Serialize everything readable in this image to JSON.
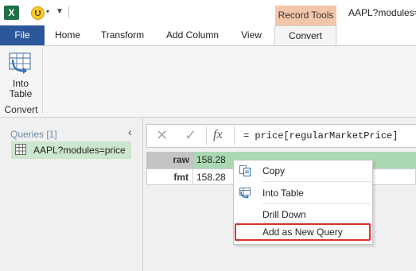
{
  "app": {
    "window_title": "AAPL?modules=",
    "contextual_tab_group": "Record Tools",
    "excel_logo_letter": "X"
  },
  "ribbon": {
    "tabs": [
      {
        "label": "File"
      },
      {
        "label": "Home"
      },
      {
        "label": "Transform"
      },
      {
        "label": "Add Column"
      },
      {
        "label": "View"
      },
      {
        "label": "Convert"
      }
    ],
    "active_tab": "Convert",
    "into_table_line1": "Into",
    "into_table_line2": "Table",
    "group_label": "Convert"
  },
  "queries": {
    "header": "Queries [1]",
    "items": [
      {
        "label": "AAPL?modules=price"
      }
    ]
  },
  "formula_bar": {
    "fx": "fx",
    "formula": "= price[regularMarketPrice]"
  },
  "record": {
    "rows": [
      {
        "field": "raw",
        "value": "158.28"
      },
      {
        "field": "fmt",
        "value": "158.28"
      }
    ]
  },
  "context_menu": {
    "items": [
      {
        "label": "Copy",
        "icon": "copy-icon"
      },
      {
        "label": "Into Table",
        "icon": "into-table-icon"
      },
      {
        "label": "Drill Down",
        "icon": ""
      },
      {
        "label": "Add as New Query",
        "icon": ""
      }
    ],
    "highlighted_item": "Add as New Query"
  },
  "colors": {
    "file_tab": "#2b579a",
    "record_tools": "#f4c6a9",
    "selected_row": "#a9d8b2",
    "highlight_border": "#d9322f",
    "excel_green": "#1e7145"
  }
}
